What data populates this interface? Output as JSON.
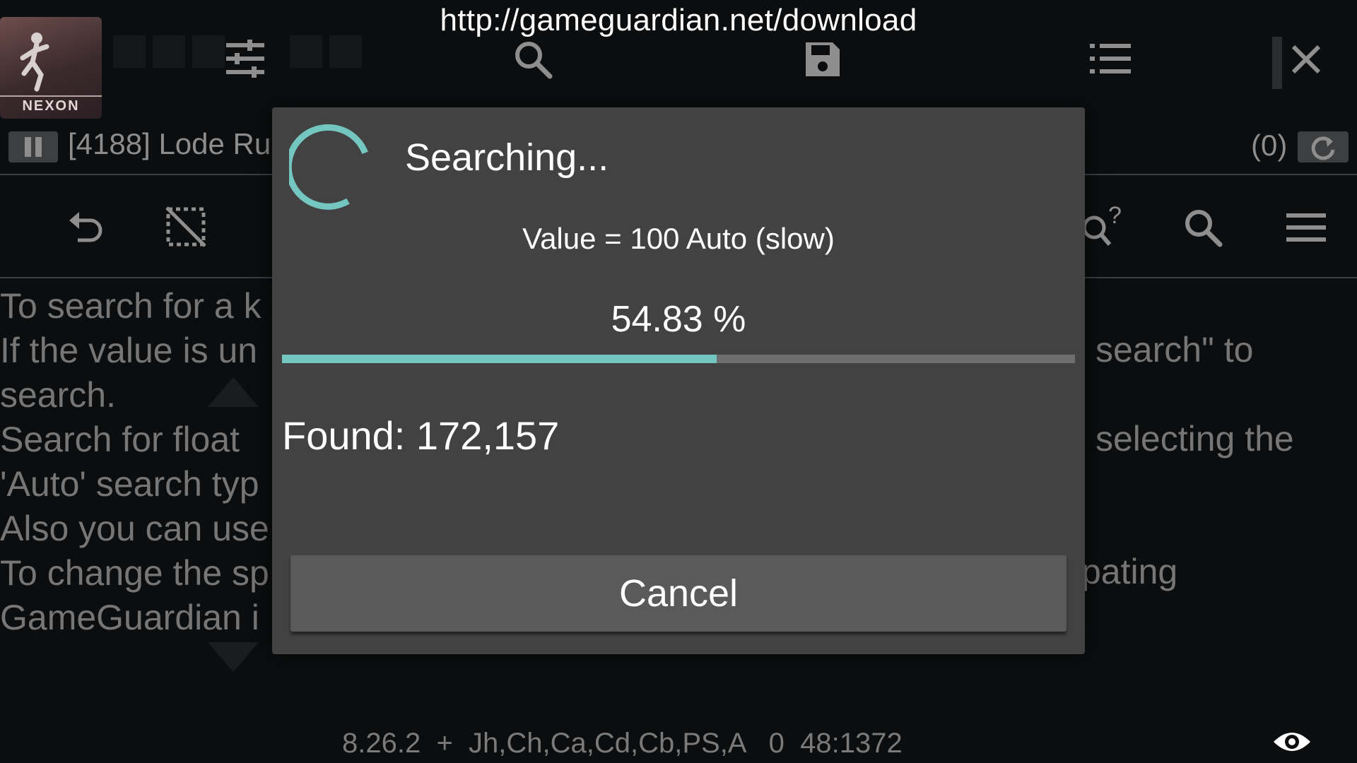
{
  "overlay": {
    "url": "http://gameguardian.net/download"
  },
  "app": {
    "logo_text": "NEXON"
  },
  "toolbar_top": {
    "icons": [
      "sliders-icon",
      "search-icon",
      "save-icon",
      "list-icon",
      "close-icon"
    ]
  },
  "process": {
    "title": "[4188] Lode Ru",
    "count": "(0)"
  },
  "toolbar_second": {
    "icons": [
      "undo-icon",
      "select-off-icon",
      "search-unknown-icon",
      "search-icon",
      "menu-icon"
    ]
  },
  "help_text": {
    "left_lines": [
      "To search for a k",
      "If the value is un",
      "search.",
      "Search for float",
      "'Auto' search typ",
      "Also you can use",
      "To change the sp",
      "GameGuardian i"
    ],
    "right_lines": [
      "search\" to",
      "selecting the",
      "pating"
    ]
  },
  "dialog": {
    "title": "Searching...",
    "value_line": "Value = 100 Auto (slow)",
    "percent_text": "54.83 %",
    "progress": 0.5483,
    "found": "Found: 172,157",
    "cancel_label": "Cancel",
    "accent_color": "#74c7c1"
  },
  "footer": {
    "status": "8.26.2  +  Jh,Ch,Ca,Cd,Cb,PS,A   0  48:1372"
  }
}
